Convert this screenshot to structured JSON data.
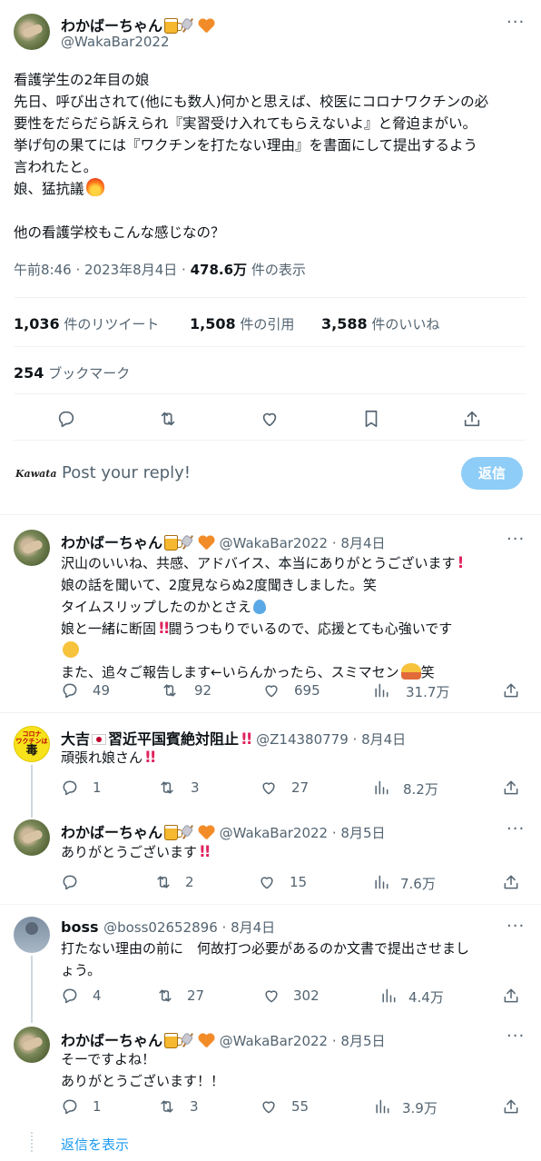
{
  "main_tweet": {
    "author_name": "わかばーちゃん",
    "author_handle": "@WakaBar2022",
    "lines": [
      "看護学生の2年目の娘",
      "先日、呼び出されて(他にも数人)何かと思えば、校医にコロナワクチンの必",
      "要性をだらだら訴えられ『実習受け入れてもらえないよ』と脅迫まがい。",
      "挙げ句の果てには『ワクチンを打たない理由』を書面にして提出するよう",
      "言われたと。",
      "娘、猛抗議",
      "",
      "他の看護学校もこんな感じなの？"
    ],
    "time": "午前8:46",
    "date": "2023年8月4日",
    "views_count": "478.6万",
    "views_label": "件の表示",
    "retweets": "1,036",
    "retweets_label": "件のリツイート",
    "quotes": "1,508",
    "quotes_label": "件の引用",
    "likes": "3,588",
    "likes_label": "件のいいね",
    "bookmarks": "254",
    "bookmarks_label": "ブックマーク"
  },
  "composer": {
    "signature": "Kawata",
    "placeholder": "Post your reply!",
    "button_label": "返信"
  },
  "replies": [
    {
      "name": "わかばーちゃん",
      "handle": "@WakaBar2022",
      "date": "8月4日",
      "lines": [
        "沢山のいいね、共感、アドバイス、本当にありがとうございます",
        "娘の話を聞いて、2度見ならぬ2度聞きしました。笑",
        "タイムスリップしたのかとさえ",
        "娘と一緒に断固",
        "闘うつもりでいるので、応援とても心強いです",
        "また、追々ご報告します←いらんかったら、スミマセン",
        "笑"
      ],
      "replies": "49",
      "retweets": "92",
      "likes": "695",
      "views": "31.7万"
    },
    {
      "name": "大吉",
      "name_suffix": "習近平国賓絶対阻止",
      "handle": "@Z14380779",
      "date": "8月4日",
      "avatar_line1": "コロナ",
      "avatar_line2": "ワクチンは",
      "avatar_line3": "毒",
      "lines": [
        "頑張れ娘さん"
      ],
      "replies": "1",
      "retweets": "3",
      "likes": "27",
      "views": "8.2万"
    },
    {
      "name": "わかばーちゃん",
      "handle": "@WakaBar2022",
      "date": "8月5日",
      "lines": [
        "ありがとうございます"
      ],
      "replies": "",
      "retweets": "2",
      "likes": "15",
      "views": "7.6万"
    },
    {
      "name": "boss",
      "handle": "@boss02652896",
      "date": "8月4日",
      "lines": [
        "打たない理由の前に　何故打つ必要があるのか文書で提出させまし",
        "ょう。"
      ],
      "replies": "4",
      "retweets": "27",
      "likes": "302",
      "views": "4.4万"
    },
    {
      "name": "わかばーちゃん",
      "handle": "@WakaBar2022",
      "date": "8月5日",
      "lines": [
        "そーですよね！",
        "ありがとうございます！！"
      ],
      "replies": "1",
      "retweets": "3",
      "likes": "55",
      "views": "3.9万"
    }
  ],
  "show_replies": "返信を表示",
  "icons": [
    "reply-icon",
    "retweet-icon",
    "like-icon",
    "bookmark-icon",
    "share-icon",
    "views-icon",
    "more-icon"
  ]
}
